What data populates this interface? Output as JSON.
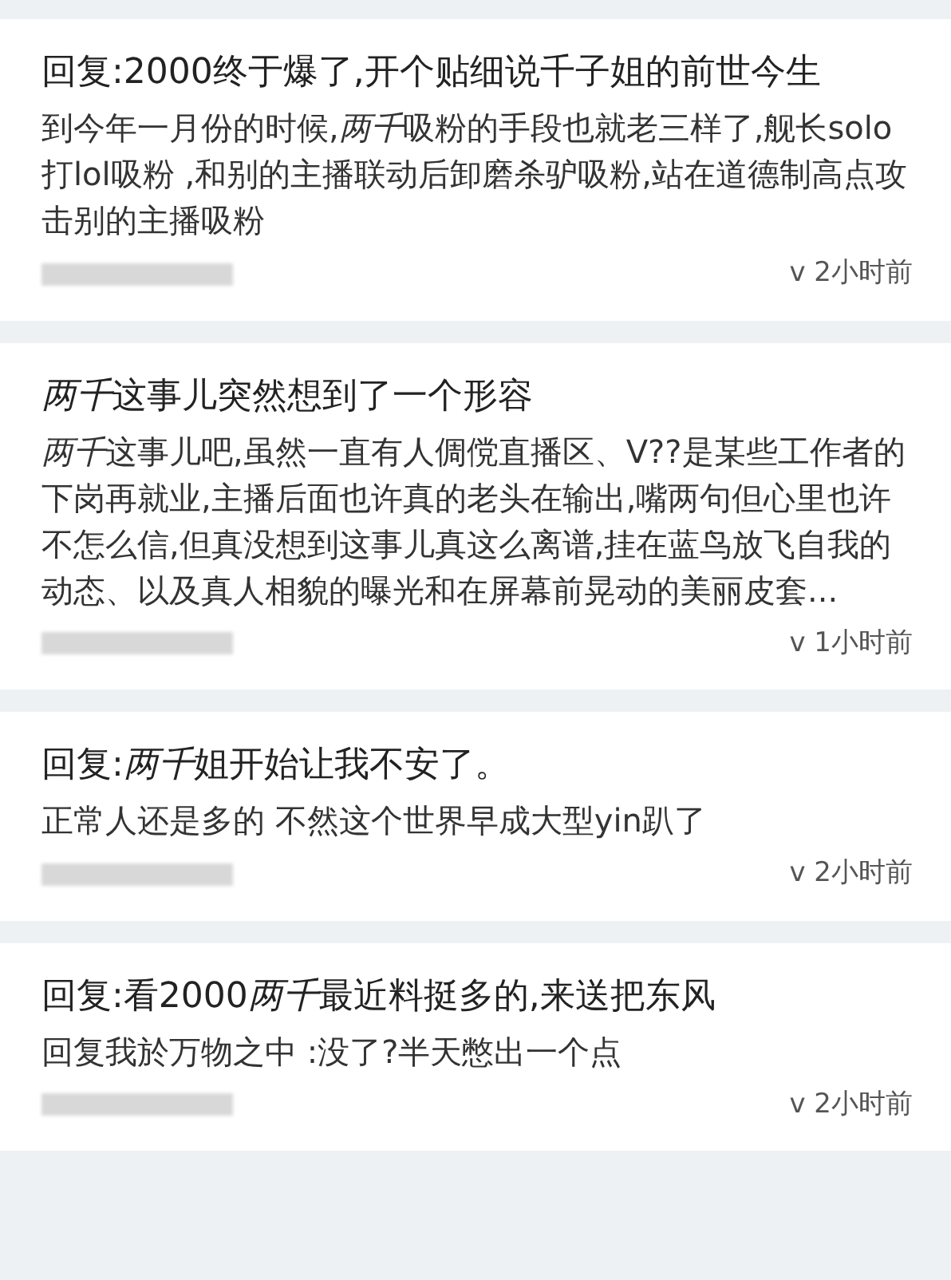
{
  "posts": [
    {
      "title": [
        {
          "text": "回复:2000终于爆了,开个贴细说千子姐的前世今生",
          "italic": false
        }
      ],
      "body": [
        {
          "text": "到今年一月份的时候,",
          "italic": false
        },
        {
          "text": "两千",
          "italic": true
        },
        {
          "text": "吸粉的手段也就老三样了,舰长solo打lol吸粉 ,和别的主播联动后卸磨杀驴吸粉,站在道德制高点攻击别的主播吸粉",
          "italic": false
        }
      ],
      "time": "v 2小时前"
    },
    {
      "title": [
        {
          "text": "两千",
          "italic": true
        },
        {
          "text": "这事儿突然想到了一个形容",
          "italic": false
        }
      ],
      "body": [
        {
          "text": "两千",
          "italic": true
        },
        {
          "text": "这事儿吧,虽然一直有人倜傥直播区、V??是某些工作者的下岗再就业,主播后面也许真的老头在输出,嘴两句但心里也许不怎么信,但真没想到这事儿真这么离谱,挂在蓝鸟放飞自我的动态、以及真人相貌的曝光和在屏幕前晃动的美丽皮套...",
          "italic": false
        }
      ],
      "time": "v 1小时前"
    },
    {
      "title": [
        {
          "text": "回复:",
          "italic": false
        },
        {
          "text": "两千",
          "italic": true
        },
        {
          "text": "姐开始让我不安了。",
          "italic": false
        }
      ],
      "body": [
        {
          "text": "正常人还是多的 不然这个世界早成大型yin趴了",
          "italic": false
        }
      ],
      "time": "v 2小时前"
    },
    {
      "title": [
        {
          "text": "回复:看2000",
          "italic": false
        },
        {
          "text": "两千",
          "italic": true
        },
        {
          "text": "最近料挺多的,来送把东风",
          "italic": false
        }
      ],
      "body": [
        {
          "text": "回复我於万物之中 :没了?半天憋出一个点",
          "italic": false
        }
      ],
      "time": "v 2小时前"
    }
  ]
}
